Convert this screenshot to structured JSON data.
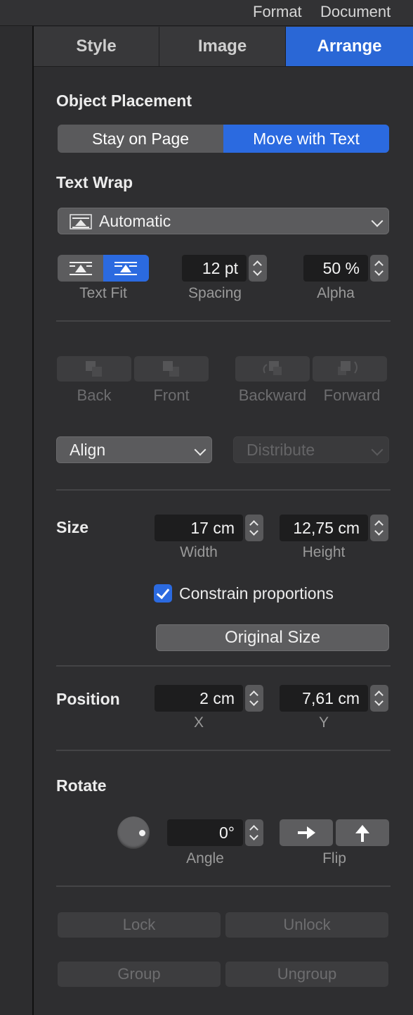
{
  "menubar": {
    "format": "Format",
    "document": "Document"
  },
  "tabs": [
    {
      "label": "Style",
      "active": false
    },
    {
      "label": "Image",
      "active": false
    },
    {
      "label": "Arrange",
      "active": true
    }
  ],
  "object_placement": {
    "title": "Object Placement",
    "options": [
      "Stay on Page",
      "Move with Text"
    ],
    "selected": "Move with Text"
  },
  "text_wrap": {
    "title": "Text Wrap",
    "selected": "Automatic",
    "text_fit_label": "Text Fit",
    "spacing_value": "12 pt",
    "spacing_label": "Spacing",
    "alpha_value": "50 %",
    "alpha_label": "Alpha"
  },
  "layer_buttons": {
    "back": "Back",
    "front": "Front",
    "backward": "Backward",
    "forward": "Forward"
  },
  "align": {
    "label": "Align",
    "distribute": "Distribute"
  },
  "size": {
    "title": "Size",
    "width_value": "17 cm",
    "width_label": "Width",
    "height_value": "12,75 cm",
    "height_label": "Height",
    "constrain_label": "Constrain proportions",
    "constrain_checked": true,
    "original_size_label": "Original Size"
  },
  "position": {
    "title": "Position",
    "x_value": "2 cm",
    "x_label": "X",
    "y_value": "7,61 cm",
    "y_label": "Y"
  },
  "rotate": {
    "title": "Rotate",
    "angle_value": "0°",
    "angle_label": "Angle",
    "flip_label": "Flip"
  },
  "bottom_buttons": {
    "lock": "Lock",
    "unlock": "Unlock",
    "group": "Group",
    "ungroup": "Ungroup"
  },
  "colors": {
    "accent": "#2b6ae0",
    "panel": "#2e2e30",
    "field": "#1d1d1e"
  }
}
